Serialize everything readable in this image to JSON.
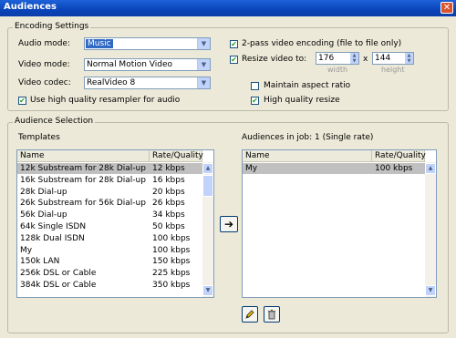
{
  "window": {
    "title": "Audiences",
    "close_label": "✕"
  },
  "encoding": {
    "group_label": "Encoding Settings",
    "audio_mode": {
      "label": "Audio mode:",
      "value": "Music"
    },
    "video_mode": {
      "label": "Video mode:",
      "value": "Normal Motion Video"
    },
    "video_codec": {
      "label": "Video codec:",
      "value": "RealVideo 8"
    },
    "hq_resampler": {
      "label": "Use high quality resampler for audio",
      "checked": true
    },
    "two_pass": {
      "label": "2-pass video encoding (file to file only)",
      "checked": true
    },
    "resize": {
      "label": "Resize video to:",
      "checked": true,
      "width": "176",
      "height": "144",
      "x_label": "x",
      "width_label": "width",
      "height_label": "height"
    },
    "aspect": {
      "label": "Maintain aspect ratio",
      "checked": false
    },
    "hq_resize": {
      "label": "High quality resize",
      "checked": true
    }
  },
  "audience": {
    "group_label": "Audience Selection",
    "templates_label": "Templates",
    "in_job_label": "Audiences in job: 1  (Single rate)",
    "columns": {
      "name": "Name",
      "rate": "Rate/Quality"
    },
    "templates": [
      {
        "name": "12k Substream for 28k Dial-up",
        "rate": "12 kbps"
      },
      {
        "name": "16k Substream for 28k Dial-up",
        "rate": "16 kbps"
      },
      {
        "name": "28k Dial-up",
        "rate": "20 kbps"
      },
      {
        "name": "26k Substream for 56k Dial-up",
        "rate": "26 kbps"
      },
      {
        "name": "56k Dial-up",
        "rate": "34 kbps"
      },
      {
        "name": "64k Single ISDN",
        "rate": "50 kbps"
      },
      {
        "name": "128k Dual ISDN",
        "rate": "100 kbps"
      },
      {
        "name": "My",
        "rate": "100 kbps"
      },
      {
        "name": "150k LAN",
        "rate": "150 kbps"
      },
      {
        "name": "256k DSL or Cable",
        "rate": "225 kbps"
      },
      {
        "name": "384k DSL or Cable",
        "rate": "350 kbps"
      }
    ],
    "job_audiences": [
      {
        "name": "My",
        "rate": "100 kbps"
      }
    ],
    "add_arrow": "➔",
    "edit_icon": "pencil-icon",
    "delete_icon": "trash-icon"
  }
}
